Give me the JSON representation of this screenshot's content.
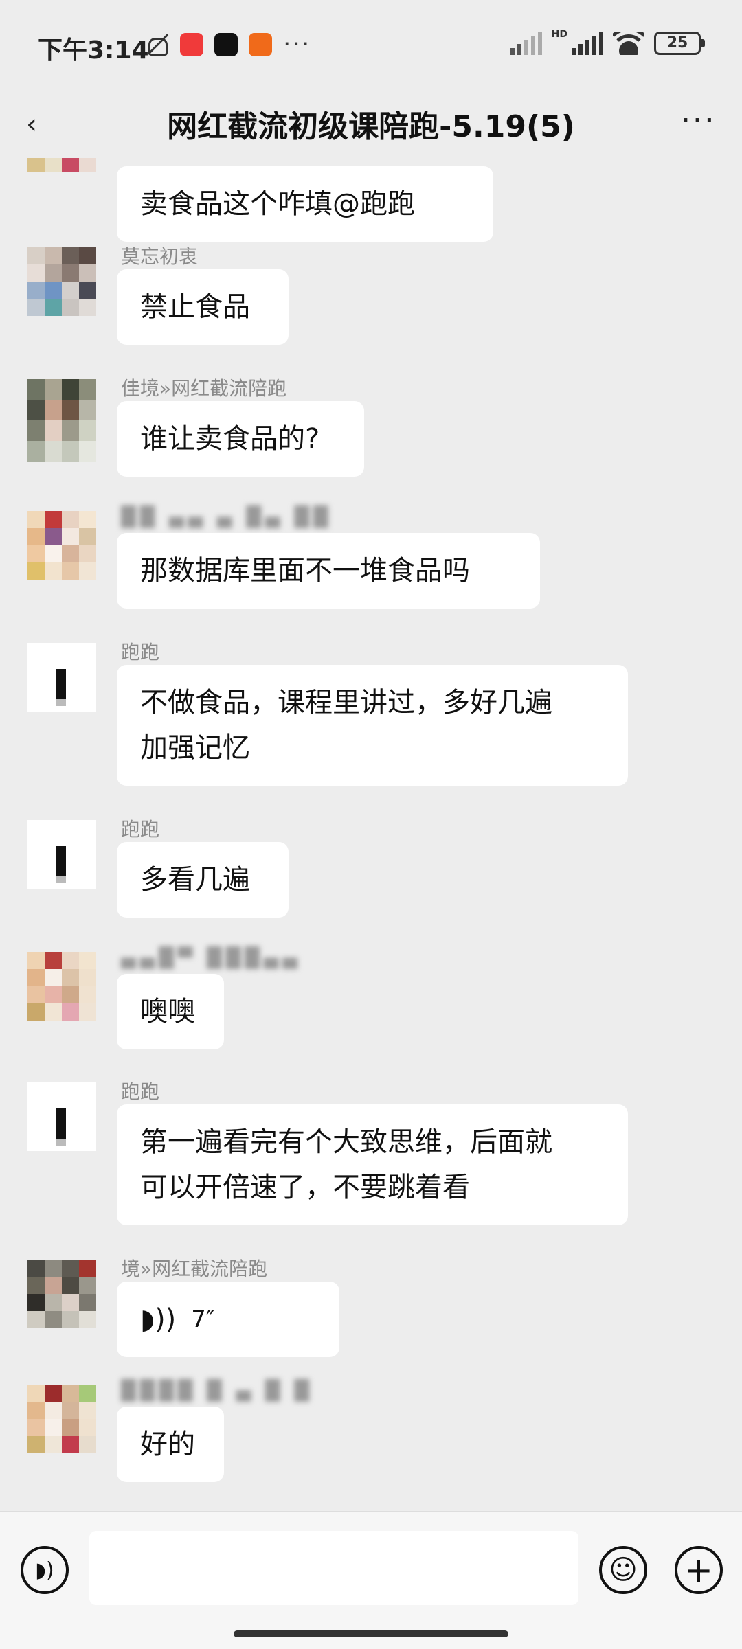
{
  "status_bar": {
    "time": "下午3:14",
    "battery": "25",
    "network": "HD",
    "more": "···",
    "app_icons": [
      "xiaohongshu-icon",
      "douyin-icon",
      "notification-app-icon"
    ]
  },
  "header": {
    "back": "‹",
    "title": "网红截流初级课陪跑-5.19(5)",
    "more": "···"
  },
  "messages": [
    {
      "sender": "",
      "text": "卖食品这个咋填@跑跑"
    },
    {
      "sender": "莫忘初衷",
      "text": "禁止食品"
    },
    {
      "sender": "佳境»网红截流陪跑",
      "text": "谁让卖食品的?"
    },
    {
      "sender": "",
      "text": "那数据库里面不一堆食品吗"
    },
    {
      "sender": "跑跑",
      "text": "不做食品，课程里讲过，多好几遍\n加强记忆"
    },
    {
      "sender": "跑跑",
      "text": "多看几遍"
    },
    {
      "sender": "",
      "text": "噢噢"
    },
    {
      "sender": "跑跑",
      "text": "第一遍看完有个大致思维，后面就\n可以开倍速了，不要跳着看"
    },
    {
      "sender": "境»网红截流陪跑",
      "text": "7″"
    },
    {
      "sender": "",
      "text": "好的"
    }
  ],
  "input_bar": {
    "placeholder": "",
    "emoji": "☺",
    "plus": "+"
  },
  "colors": {
    "background": "#ededed",
    "bubble": "#ffffff",
    "sender": "#8a8a8a"
  }
}
